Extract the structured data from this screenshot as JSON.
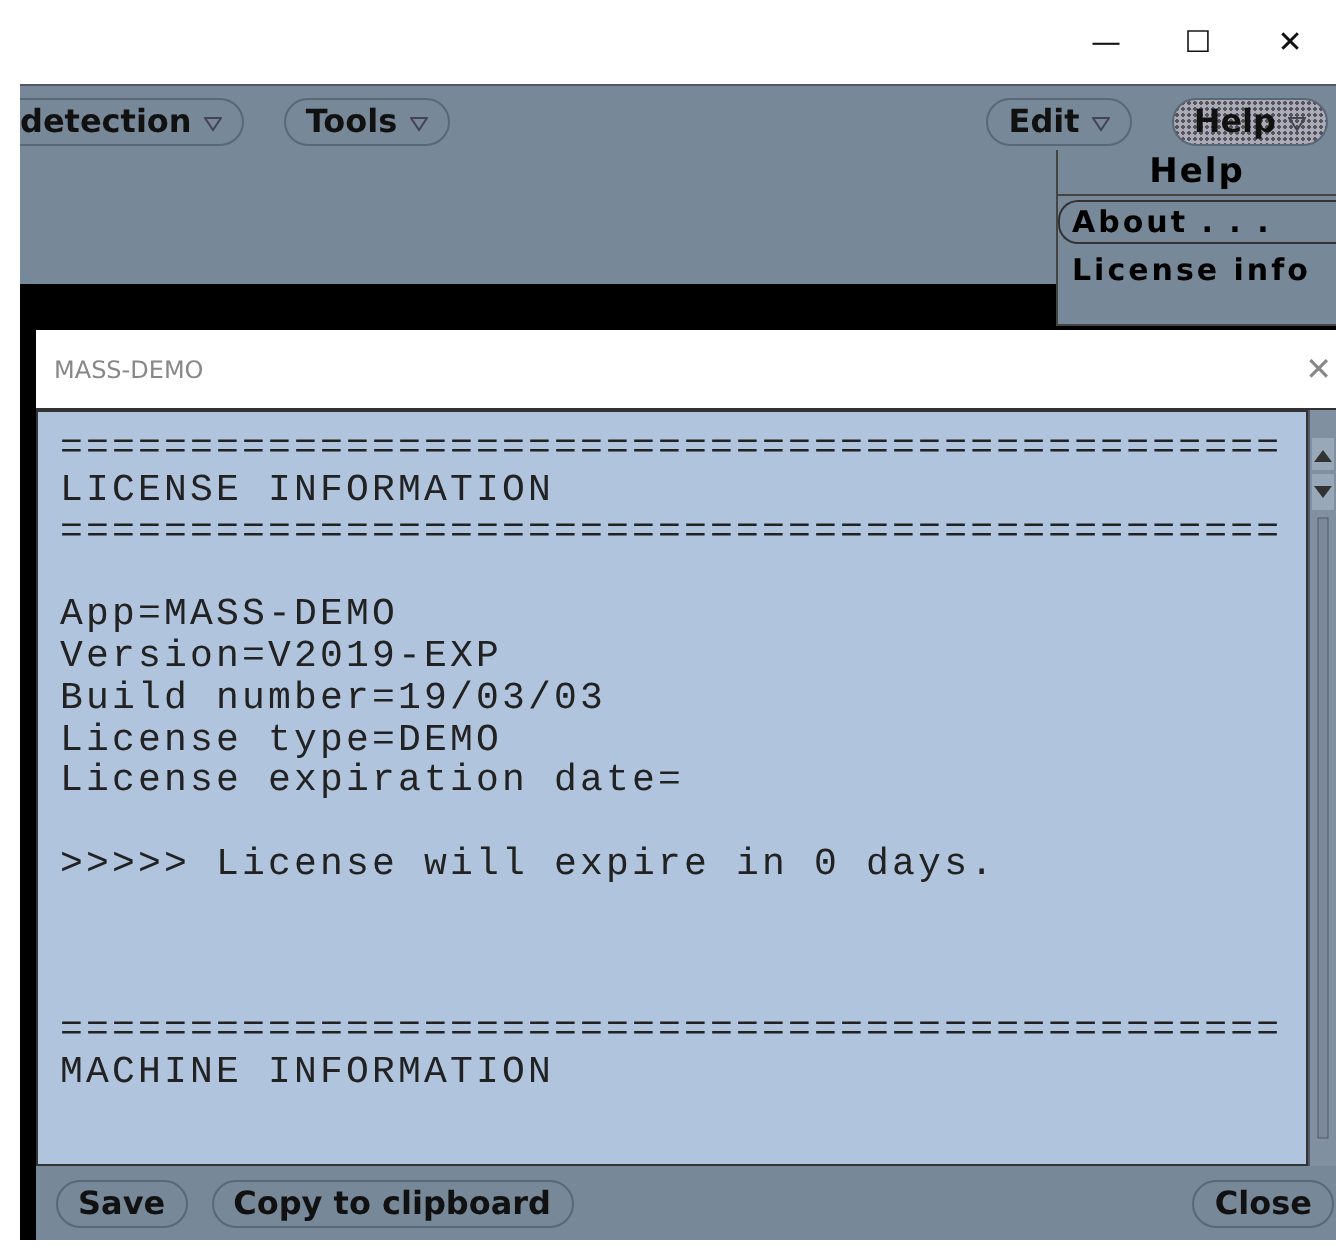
{
  "window": {
    "controls": [
      "—",
      "☐",
      "✕"
    ]
  },
  "menubar": {
    "left_menus": [
      {
        "label": "detection",
        "selected": false
      },
      {
        "label": "Tools",
        "selected": false
      }
    ],
    "right_menus": [
      {
        "label": "Edit",
        "selected": false
      },
      {
        "label": "Help",
        "selected": true
      }
    ]
  },
  "help_menu": {
    "title": "Help",
    "items": [
      {
        "label": "About . . .",
        "selected": true
      },
      {
        "label": "License info",
        "selected": false
      }
    ]
  },
  "dialog": {
    "title": "MASS-DEMO",
    "close": "✕",
    "lines": [
      {
        "kind": "text",
        "text": "==============================================="
      },
      {
        "kind": "text",
        "text": "LICENSE INFORMATION"
      },
      {
        "kind": "text",
        "text": "==============================================="
      },
      {
        "kind": "blank"
      },
      {
        "kind": "text",
        "text": "App=MASS-DEMO"
      },
      {
        "kind": "text",
        "text": "Version=V2019-EXP"
      },
      {
        "kind": "text",
        "text": "Build number=19/03/03"
      },
      {
        "kind": "text",
        "text": "License type=DEMO"
      },
      {
        "kind": "text",
        "text": "License expiration date="
      },
      {
        "kind": "blank"
      },
      {
        "kind": "text",
        "text": ">>>>> License will expire in 0 days."
      },
      {
        "kind": "blank"
      },
      {
        "kind": "blank"
      },
      {
        "kind": "blank"
      },
      {
        "kind": "text",
        "text": "==============================================="
      },
      {
        "kind": "text",
        "text": "MACHINE INFORMATION"
      }
    ],
    "left_buttons": [
      "Save",
      "Copy to clipboard"
    ],
    "right_buttons": [
      "Close"
    ]
  }
}
